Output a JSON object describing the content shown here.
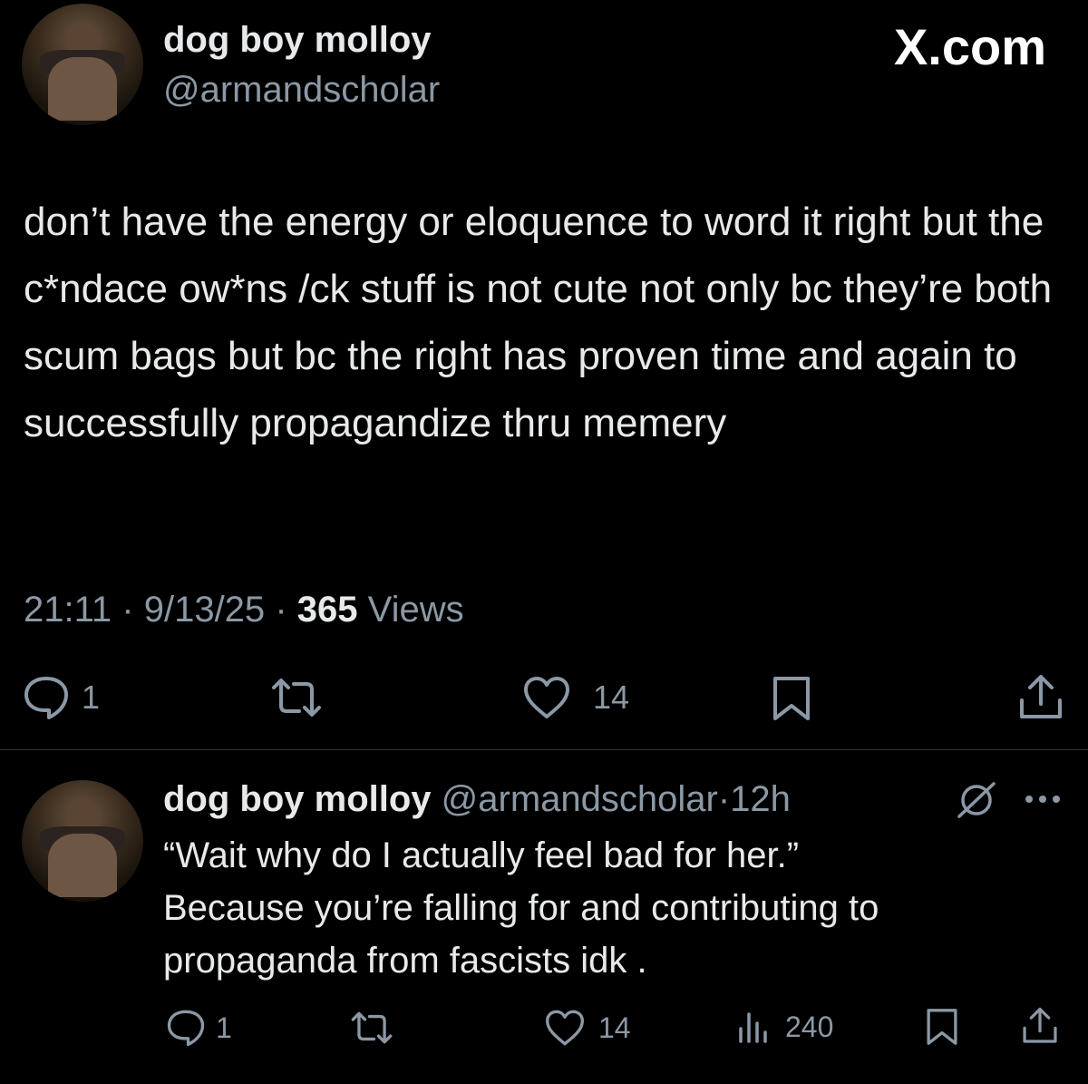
{
  "main_post": {
    "display_name": "dog boy molloy",
    "handle": "@armandscholar",
    "brand": "X.com",
    "text": "don’t have the energy or eloquence to word it right but the c*ndace ow*ns /ck stuff is not cute not only bc they’re both scum bags but bc the right has proven time and again to successfully propagandize thru memery",
    "time": "21:11",
    "date": "9/13/25",
    "views_count": "365",
    "views_label": "Views",
    "replies": "1",
    "likes": "14"
  },
  "reply_post": {
    "display_name": "dog boy molloy",
    "handle": "@armandscholar",
    "age": "12h",
    "text_line1": "“Wait why do I actually feel bad for her.”",
    "text_line2": "Because you’re falling for and contributing to propaganda from fascists idk .",
    "replies": "1",
    "likes": "14",
    "views": "240"
  },
  "separator": "·",
  "icons": [
    "reply-icon",
    "repost-icon",
    "like-icon",
    "bookmark-icon",
    "share-icon",
    "views-icon",
    "grok-icon",
    "more-icon"
  ]
}
